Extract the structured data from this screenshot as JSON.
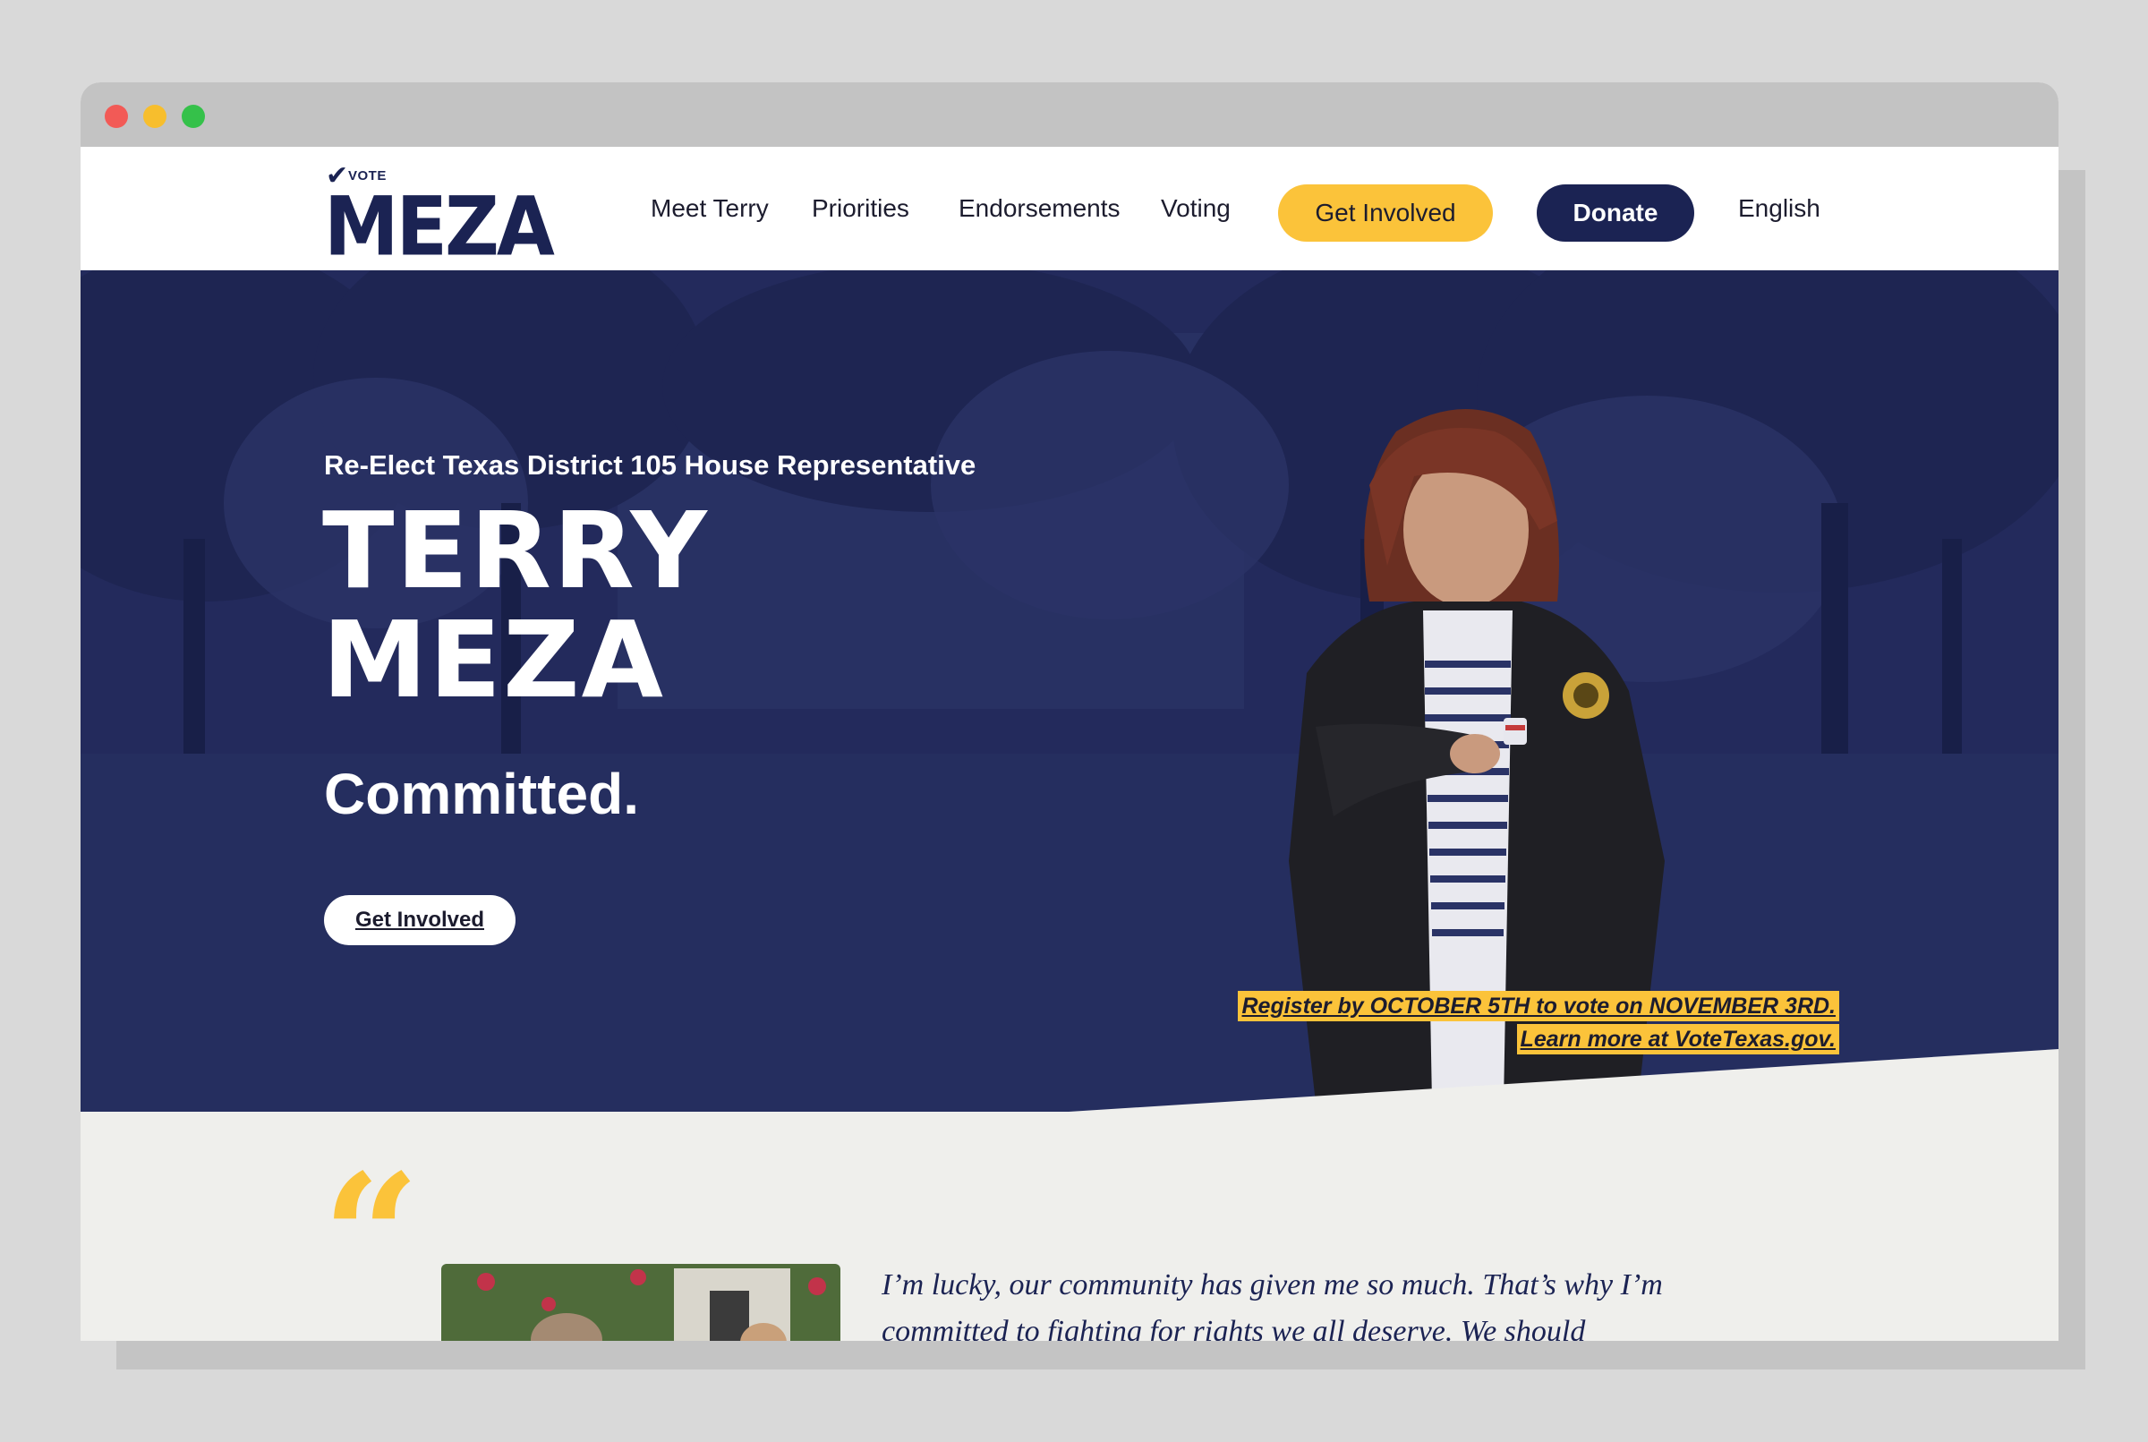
{
  "colors": {
    "navy": "#1b2353",
    "accent_yellow": "#fbc33a",
    "light_bg": "#efefec"
  },
  "browser": {
    "controls": [
      "close",
      "minimize",
      "maximize"
    ]
  },
  "nav": {
    "logo": {
      "small": "VOTE",
      "name": "MEZA",
      "icon": "checkmark-icon"
    },
    "links": [
      "Meet Terry",
      "Priorities",
      "Endorsements",
      "Voting"
    ],
    "get_involved": "Get Involved",
    "donate": "Donate",
    "language": "English"
  },
  "hero": {
    "subtitle": "Re-Elect Texas District 105 House Representative",
    "name_line1": "TERRY",
    "name_line2": "MEZA",
    "tagline": "Committed.",
    "cta": "Get Involved",
    "notice_line1": "Register by OCTOBER 5TH to vote on NOVEMBER 3RD.",
    "notice_line2": "Learn more at VoteTexas.gov."
  },
  "testimonial": {
    "quote_icon": "quote-icon",
    "text": "I’m lucky, our community has given me so much. That’s why I’m committed to fighting for rights we all deserve. We should"
  }
}
